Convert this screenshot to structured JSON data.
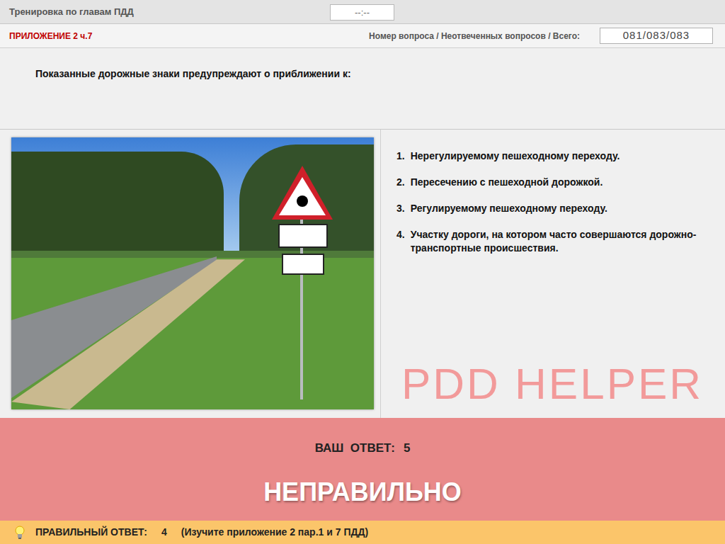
{
  "header": {
    "title": "Тренировка по главам ПДД",
    "timer": "--:--"
  },
  "subheader": {
    "section": "ПРИЛОЖЕНИЕ 2 ч.7",
    "counter_label": "Номер вопроса / Неотвеченных вопросов / Всего:",
    "counter": "081/083/083"
  },
  "question": {
    "text": "Показанные дорожные знаки предупреждают о приближении к:"
  },
  "answers": [
    {
      "number": "1.",
      "text": "Нерегулируемому пешеходному переходу."
    },
    {
      "number": "2.",
      "text": "Пересечению с пешеходной дорожкой."
    },
    {
      "number": "3.",
      "text": "Регулируемому пешеходному переходу."
    },
    {
      "number": "4.",
      "text": "Участку дороги, на котором часто совершаются дорожно-транспортные происшествия."
    }
  ],
  "watermark": "PDD HELPER",
  "result": {
    "label": "ВАШ  ОТВЕТ:",
    "value": "5",
    "verdict": "НЕПРАВИЛЬНО"
  },
  "hint": {
    "label": "ПРАВИЛЬНЫЙ ОТВЕТ:",
    "value": "4",
    "note": "(Изучите приложение 2 пар.1 и 7 ПДД)"
  }
}
